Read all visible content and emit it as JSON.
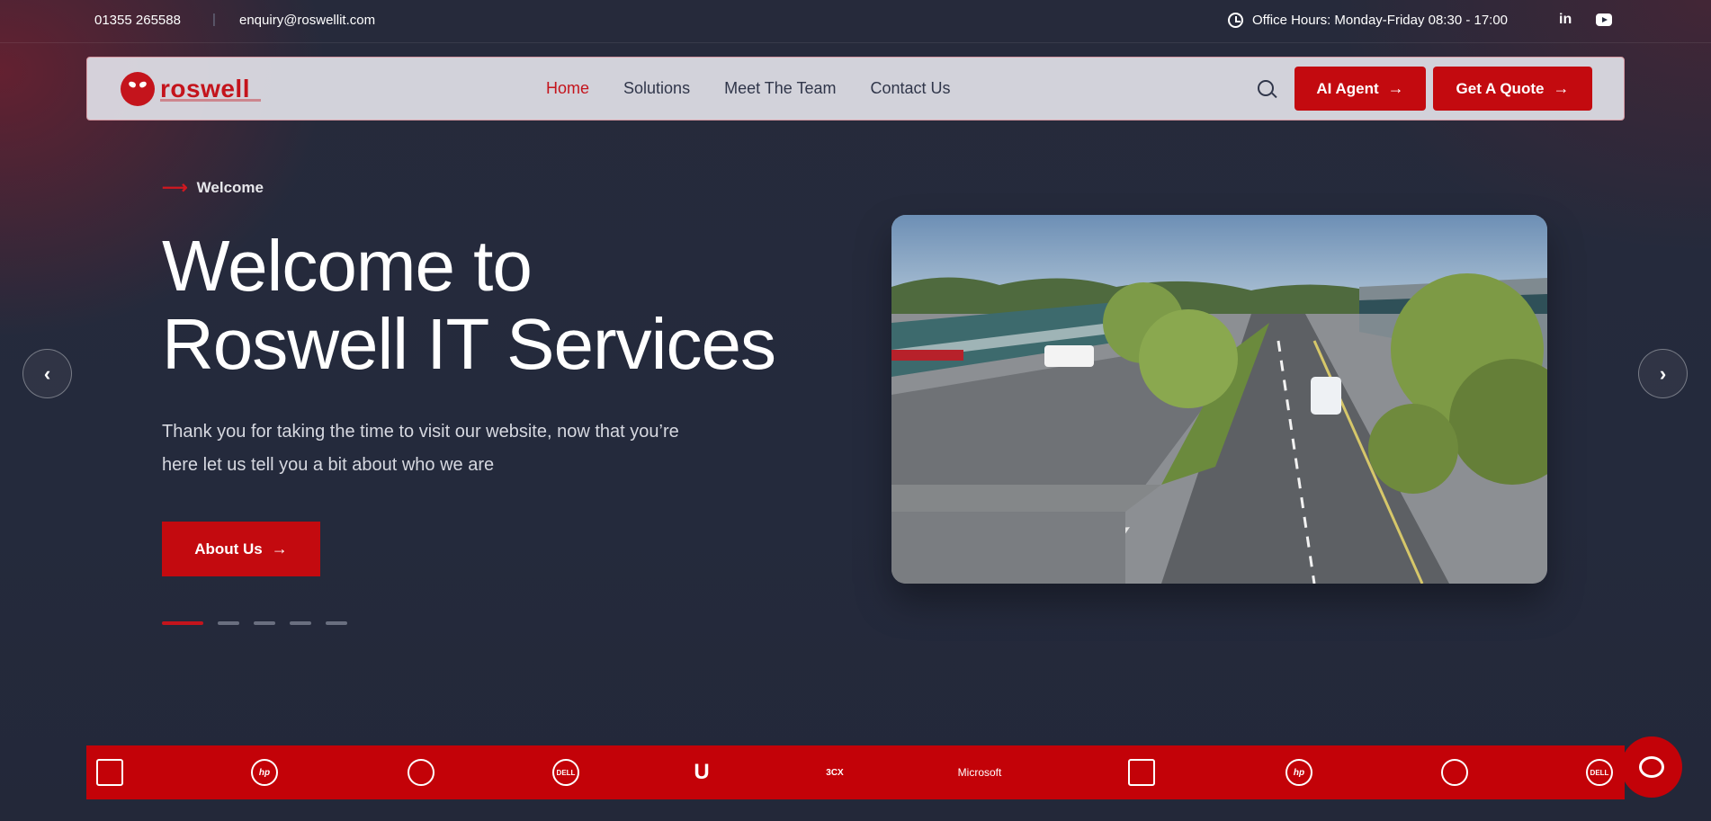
{
  "topbar": {
    "phone": "01355 265588",
    "separator": "|",
    "email": "enquiry@roswellit.com",
    "hours": "Office Hours: Monday-Friday 08:30 - 17:00",
    "linkedin": "in"
  },
  "nav": {
    "logo": "roswell",
    "menu": [
      "Home",
      "Solutions",
      "Meet The Team",
      "Contact Us"
    ],
    "active": "Home",
    "ai_agent": "AI Agent",
    "quote": "Get A Quote"
  },
  "hero": {
    "tag": "Welcome",
    "title_line1": "Welcome to",
    "title_line2": "Roswell IT Services",
    "subtitle_line1": "Thank you for taking the time to visit our website, now that you’re",
    "subtitle_line2": "here let us tell you a bit about who we are",
    "cta": "About Us",
    "slide_count": 5,
    "active_slide": 1
  },
  "partners": [
    "hp",
    "DELL",
    "3CX",
    "Microsoft",
    "hp",
    "DELL"
  ],
  "colors": {
    "accent": "#c30a0f",
    "background": "#252a3c"
  }
}
